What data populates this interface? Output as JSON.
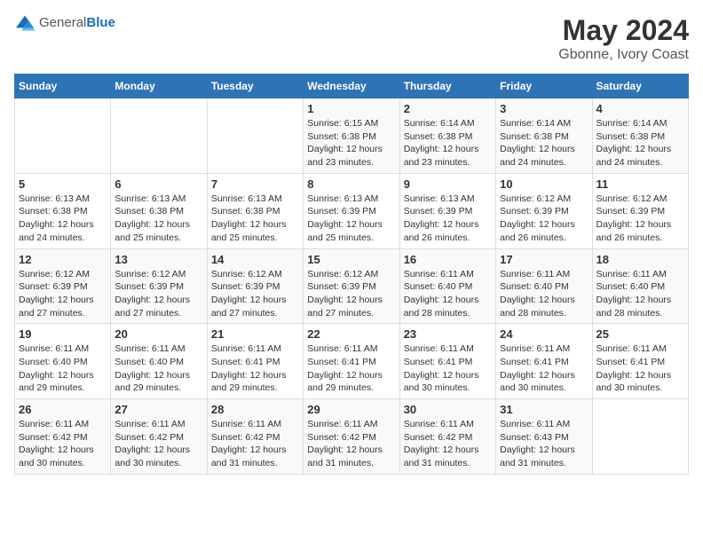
{
  "header": {
    "logo_general": "General",
    "logo_blue": "Blue",
    "title": "May 2024",
    "subtitle": "Gbonne, Ivory Coast"
  },
  "days_of_week": [
    "Sunday",
    "Monday",
    "Tuesday",
    "Wednesday",
    "Thursday",
    "Friday",
    "Saturday"
  ],
  "weeks": [
    [
      {
        "day": "",
        "info": ""
      },
      {
        "day": "",
        "info": ""
      },
      {
        "day": "",
        "info": ""
      },
      {
        "day": "1",
        "info": "Sunrise: 6:15 AM\nSunset: 6:38 PM\nDaylight: 12 hours\nand 23 minutes."
      },
      {
        "day": "2",
        "info": "Sunrise: 6:14 AM\nSunset: 6:38 PM\nDaylight: 12 hours\nand 23 minutes."
      },
      {
        "day": "3",
        "info": "Sunrise: 6:14 AM\nSunset: 6:38 PM\nDaylight: 12 hours\nand 24 minutes."
      },
      {
        "day": "4",
        "info": "Sunrise: 6:14 AM\nSunset: 6:38 PM\nDaylight: 12 hours\nand 24 minutes."
      }
    ],
    [
      {
        "day": "5",
        "info": "Sunrise: 6:13 AM\nSunset: 6:38 PM\nDaylight: 12 hours\nand 24 minutes."
      },
      {
        "day": "6",
        "info": "Sunrise: 6:13 AM\nSunset: 6:38 PM\nDaylight: 12 hours\nand 25 minutes."
      },
      {
        "day": "7",
        "info": "Sunrise: 6:13 AM\nSunset: 6:38 PM\nDaylight: 12 hours\nand 25 minutes."
      },
      {
        "day": "8",
        "info": "Sunrise: 6:13 AM\nSunset: 6:39 PM\nDaylight: 12 hours\nand 25 minutes."
      },
      {
        "day": "9",
        "info": "Sunrise: 6:13 AM\nSunset: 6:39 PM\nDaylight: 12 hours\nand 26 minutes."
      },
      {
        "day": "10",
        "info": "Sunrise: 6:12 AM\nSunset: 6:39 PM\nDaylight: 12 hours\nand 26 minutes."
      },
      {
        "day": "11",
        "info": "Sunrise: 6:12 AM\nSunset: 6:39 PM\nDaylight: 12 hours\nand 26 minutes."
      }
    ],
    [
      {
        "day": "12",
        "info": "Sunrise: 6:12 AM\nSunset: 6:39 PM\nDaylight: 12 hours\nand 27 minutes."
      },
      {
        "day": "13",
        "info": "Sunrise: 6:12 AM\nSunset: 6:39 PM\nDaylight: 12 hours\nand 27 minutes."
      },
      {
        "day": "14",
        "info": "Sunrise: 6:12 AM\nSunset: 6:39 PM\nDaylight: 12 hours\nand 27 minutes."
      },
      {
        "day": "15",
        "info": "Sunrise: 6:12 AM\nSunset: 6:39 PM\nDaylight: 12 hours\nand 27 minutes."
      },
      {
        "day": "16",
        "info": "Sunrise: 6:11 AM\nSunset: 6:40 PM\nDaylight: 12 hours\nand 28 minutes."
      },
      {
        "day": "17",
        "info": "Sunrise: 6:11 AM\nSunset: 6:40 PM\nDaylight: 12 hours\nand 28 minutes."
      },
      {
        "day": "18",
        "info": "Sunrise: 6:11 AM\nSunset: 6:40 PM\nDaylight: 12 hours\nand 28 minutes."
      }
    ],
    [
      {
        "day": "19",
        "info": "Sunrise: 6:11 AM\nSunset: 6:40 PM\nDaylight: 12 hours\nand 29 minutes."
      },
      {
        "day": "20",
        "info": "Sunrise: 6:11 AM\nSunset: 6:40 PM\nDaylight: 12 hours\nand 29 minutes."
      },
      {
        "day": "21",
        "info": "Sunrise: 6:11 AM\nSunset: 6:41 PM\nDaylight: 12 hours\nand 29 minutes."
      },
      {
        "day": "22",
        "info": "Sunrise: 6:11 AM\nSunset: 6:41 PM\nDaylight: 12 hours\nand 29 minutes."
      },
      {
        "day": "23",
        "info": "Sunrise: 6:11 AM\nSunset: 6:41 PM\nDaylight: 12 hours\nand 30 minutes."
      },
      {
        "day": "24",
        "info": "Sunrise: 6:11 AM\nSunset: 6:41 PM\nDaylight: 12 hours\nand 30 minutes."
      },
      {
        "day": "25",
        "info": "Sunrise: 6:11 AM\nSunset: 6:41 PM\nDaylight: 12 hours\nand 30 minutes."
      }
    ],
    [
      {
        "day": "26",
        "info": "Sunrise: 6:11 AM\nSunset: 6:42 PM\nDaylight: 12 hours\nand 30 minutes."
      },
      {
        "day": "27",
        "info": "Sunrise: 6:11 AM\nSunset: 6:42 PM\nDaylight: 12 hours\nand 30 minutes."
      },
      {
        "day": "28",
        "info": "Sunrise: 6:11 AM\nSunset: 6:42 PM\nDaylight: 12 hours\nand 31 minutes."
      },
      {
        "day": "29",
        "info": "Sunrise: 6:11 AM\nSunset: 6:42 PM\nDaylight: 12 hours\nand 31 minutes."
      },
      {
        "day": "30",
        "info": "Sunrise: 6:11 AM\nSunset: 6:42 PM\nDaylight: 12 hours\nand 31 minutes."
      },
      {
        "day": "31",
        "info": "Sunrise: 6:11 AM\nSunset: 6:43 PM\nDaylight: 12 hours\nand 31 minutes."
      },
      {
        "day": "",
        "info": ""
      }
    ]
  ]
}
